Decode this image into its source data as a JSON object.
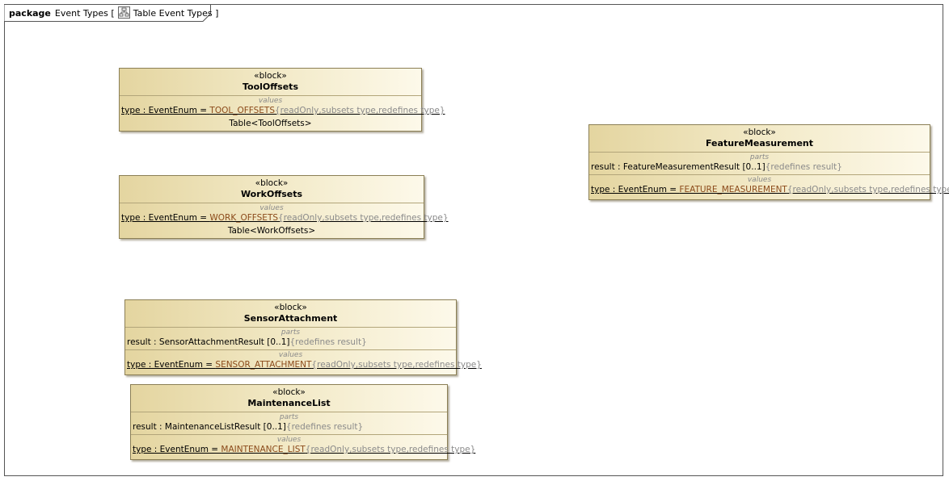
{
  "frame": {
    "keyword": "package",
    "name": "Event Types [",
    "diagram_icon": "diagram-icon",
    "diagram_name": "Table Event Types ]"
  },
  "blocks": {
    "tool_offsets": {
      "stereotype": "«block»",
      "name": "ToolOffsets",
      "values_title": "values",
      "value_prefix": "type : EventEnum = ",
      "value_literal": "TOOL_OFFSETS",
      "value_props": "{readOnly,subsets type,redefines type}",
      "table_label": "Table<ToolOffsets>"
    },
    "work_offsets": {
      "stereotype": "«block»",
      "name": "WorkOffsets",
      "values_title": "values",
      "value_prefix": "type : EventEnum = ",
      "value_literal": "WORK_OFFSETS",
      "value_props": "{readOnly,subsets type,redefines type}",
      "table_label": "Table<WorkOffsets>"
    },
    "feature_measurement": {
      "stereotype": "«block»",
      "name": "FeatureMeasurement",
      "parts_title": "parts",
      "part_text": "result : FeatureMeasurementResult [0..1]",
      "part_props": "{redefines result}",
      "values_title": "values",
      "value_prefix": "type : EventEnum = ",
      "value_literal": "FEATURE_MEASUREMENT",
      "value_props": "{readOnly,subsets type,redefines type}"
    },
    "sensor_attachment": {
      "stereotype": "«block»",
      "name": "SensorAttachment",
      "parts_title": "parts",
      "part_text": "result : SensorAttachmentResult [0..1]",
      "part_props": "{redefines result}",
      "values_title": "values",
      "value_prefix": "type : EventEnum = ",
      "value_literal": "SENSOR_ATTACHMENT",
      "value_props": "{readOnly,subsets type,redefines type}"
    },
    "maintenance_list": {
      "stereotype": "«block»",
      "name": "MaintenanceList",
      "parts_title": "parts",
      "part_text": "result : MaintenanceListResult [0..1]",
      "part_props": "{redefines result}",
      "values_title": "values",
      "value_prefix": "type : EventEnum = ",
      "value_literal": "MAINTENANCE_LIST",
      "value_props": "{readOnly,subsets type,redefines type}"
    }
  },
  "colors": {
    "block_fill_start": "#e4d5a0",
    "block_fill_end": "#fdf9ea",
    "block_border": "#8b7f55",
    "literal_text": "#8b4a1a",
    "constraint_text": "#8a8a8a"
  }
}
